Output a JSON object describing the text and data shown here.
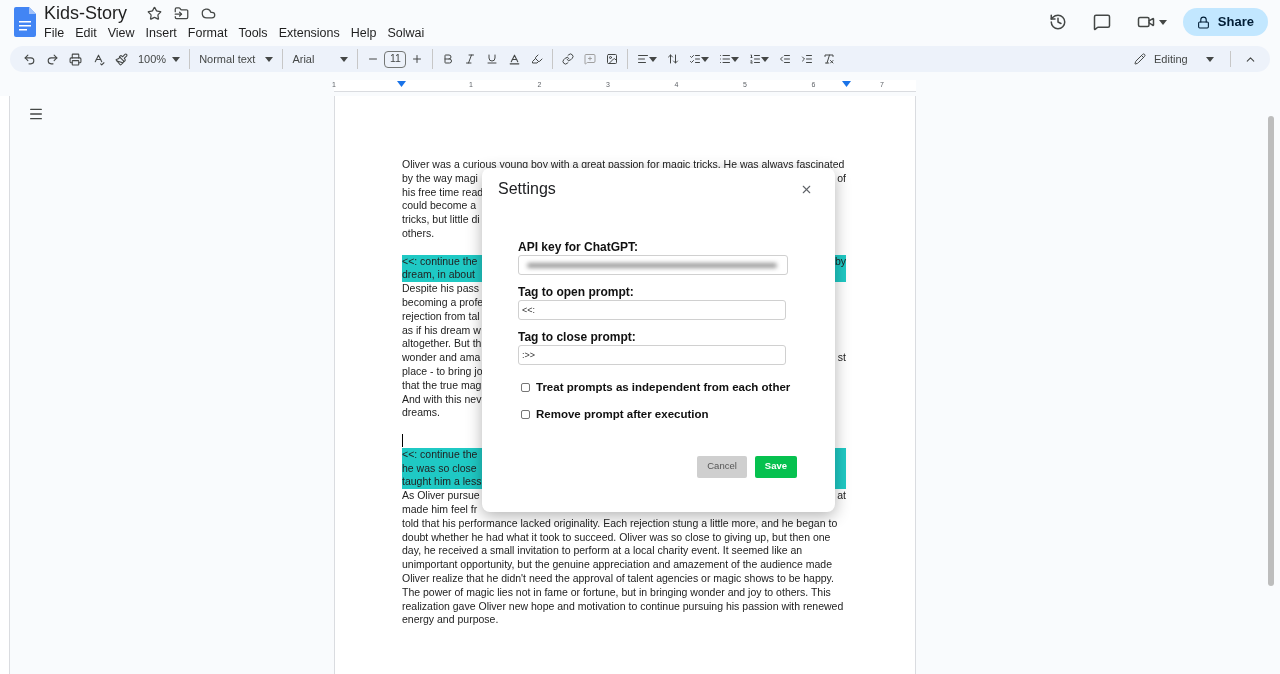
{
  "document": {
    "title": "Kids-Story"
  },
  "menu": [
    "File",
    "Edit",
    "View",
    "Insert",
    "Format",
    "Tools",
    "Extensions",
    "Help",
    "Solwai"
  ],
  "share_button": "Share",
  "toolbar": {
    "zoom": "100%",
    "style": "Normal text",
    "font": "Arial",
    "font_size": "11",
    "mode": "Editing"
  },
  "ruler": [
    "1",
    "1",
    "2",
    "3",
    "4",
    "5",
    "6",
    "7"
  ],
  "page": {
    "lines": [
      {
        "kind": "full",
        "text": "Oliver was a curious young boy with a great passion for magic tricks. He was always fascinated",
        "highlighted": false
      },
      {
        "kind": "split",
        "left": "by the way magi",
        "right": "of",
        "highlighted": false
      },
      {
        "kind": "split",
        "left": "his free time read",
        "highlighted": false
      },
      {
        "kind": "split",
        "left": "could become a",
        "highlighted": false
      },
      {
        "kind": "split",
        "left": "tricks, but little di",
        "highlighted": false
      },
      {
        "kind": "split",
        "left": "others.",
        "highlighted": false
      },
      {
        "kind": "gap"
      },
      {
        "kind": "split",
        "left": "<<: continue the",
        "right": "by",
        "highlighted": true
      },
      {
        "kind": "split",
        "left": "dream, in about",
        "highlighted": true
      },
      {
        "kind": "split",
        "left": "Despite his pass",
        "highlighted": false
      },
      {
        "kind": "split",
        "left": "becoming a profe",
        "highlighted": false
      },
      {
        "kind": "split",
        "left": "rejection from tal",
        "highlighted": false
      },
      {
        "kind": "split",
        "left": "as if his dream w",
        "highlighted": false
      },
      {
        "kind": "split",
        "left": "altogether. But th",
        "highlighted": false
      },
      {
        "kind": "split",
        "left": "wonder and ama",
        "right": "st",
        "highlighted": false
      },
      {
        "kind": "split",
        "left": "place - to bring jo",
        "highlighted": false
      },
      {
        "kind": "split",
        "left": "that the true mag",
        "highlighted": false
      },
      {
        "kind": "split",
        "left": "And with this nev",
        "highlighted": false
      },
      {
        "kind": "split",
        "left": "dreams.",
        "highlighted": false
      },
      {
        "kind": "gap"
      },
      {
        "kind": "cursor"
      },
      {
        "kind": "split",
        "left": "<<: continue the",
        "highlighted": true
      },
      {
        "kind": "split",
        "left": "he was so close",
        "highlighted": true
      },
      {
        "kind": "split",
        "left": "taught him a less",
        "highlighted": true
      },
      {
        "kind": "split",
        "left": "As Oliver pursue",
        "right": "at",
        "highlighted": false
      },
      {
        "kind": "split",
        "left": "made him feel fr",
        "highlighted": false
      },
      {
        "kind": "full",
        "text": "told that his performance lacked originality. Each rejection stung a little more, and he began to",
        "highlighted": false
      },
      {
        "kind": "full",
        "text": "doubt whether he had what it took to succeed. Oliver was so close to giving up, but then one",
        "highlighted": false
      },
      {
        "kind": "full",
        "text": "day, he received a small invitation to perform at a local charity event. It seemed like an",
        "highlighted": false
      },
      {
        "kind": "full",
        "text": "unimportant opportunity, but the genuine appreciation and amazement of the audience made",
        "highlighted": false
      },
      {
        "kind": "full",
        "text": "Oliver realize that he didn't need the approval of talent agencies or magic shows to be happy.",
        "highlighted": false
      },
      {
        "kind": "full",
        "text": "The power of magic lies not in fame or fortune, but in bringing wonder and joy to others. This",
        "highlighted": false
      },
      {
        "kind": "full",
        "text": "realization gave Oliver new hope and motivation to continue pursuing his passion with renewed",
        "highlighted": false
      },
      {
        "kind": "full",
        "text": "energy and purpose.",
        "highlighted": false
      }
    ]
  },
  "dialog": {
    "title": "Settings",
    "fields": [
      {
        "label": "API key for ChatGPT:",
        "kind": "blurred"
      },
      {
        "label": "Tag to open prompt:",
        "kind": "text",
        "value": "<<:"
      },
      {
        "label": "Tag to close prompt:",
        "kind": "text",
        "value": ":>>"
      }
    ],
    "options": [
      {
        "label": "Treat prompts as independent from each other",
        "checked": false
      },
      {
        "label": "Remove prompt after execution",
        "checked": false
      }
    ],
    "buttons": [
      {
        "label": "Cancel",
        "kind": "secondary"
      },
      {
        "label": "Save",
        "kind": "primary"
      }
    ]
  }
}
